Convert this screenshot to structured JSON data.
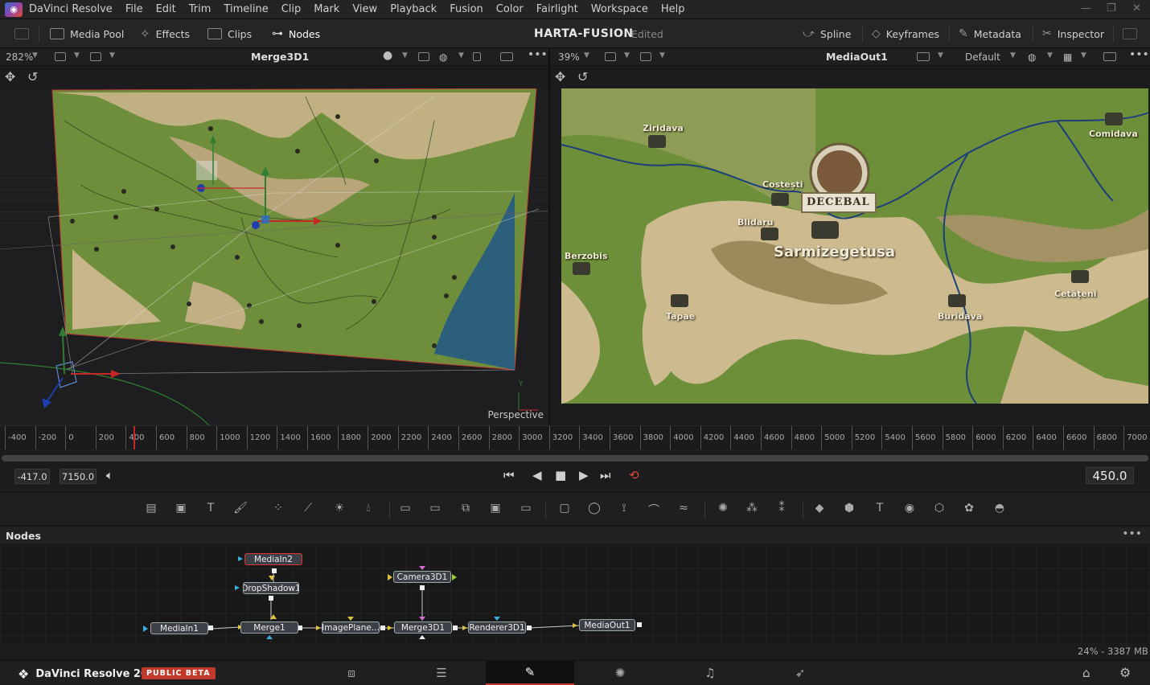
{
  "app": {
    "name": "DaVinci Resolve"
  },
  "menu": [
    "File",
    "Edit",
    "Trim",
    "Timeline",
    "Clip",
    "Mark",
    "View",
    "Playback",
    "Fusion",
    "Color",
    "Fairlight",
    "Workspace",
    "Help"
  ],
  "toolbar": {
    "media_pool": "Media Pool",
    "effects": "Effects",
    "clips": "Clips",
    "nodes": "Nodes",
    "project_title": "HARTA-FUSION",
    "project_status": "Edited",
    "spline": "Spline",
    "keyframes": "Keyframes",
    "metadata": "Metadata",
    "inspector": "Inspector"
  },
  "viewer_left": {
    "zoom": "282%",
    "node_name": "Merge3D1",
    "view_label": "Perspective"
  },
  "viewer_right": {
    "zoom": "39%",
    "node_name": "MediaOut1",
    "lut": "Default"
  },
  "map_labels": {
    "ziridava": "Ziridava",
    "comidava": "Comidava",
    "costesti": "Costești",
    "blidaru": "Blidaru",
    "decebal": "DECEBAL",
    "sarmizegetusa": "Sarmizegetusa",
    "berzobis": "Berzobis",
    "tapae": "Tapae",
    "buridava": "Buridava",
    "cetateni": "Cetățeni"
  },
  "ruler": {
    "ticks": [
      "-400",
      "-200",
      "0",
      "200",
      "400",
      "600",
      "800",
      "1000",
      "1200",
      "1400",
      "1600",
      "1800",
      "2000",
      "2200",
      "2400",
      "2600",
      "2800",
      "3000",
      "3200",
      "3400",
      "3600",
      "3800",
      "4000",
      "4200",
      "4400",
      "4600",
      "4800",
      "5000",
      "5200",
      "5400",
      "5600",
      "5800",
      "6000",
      "6200",
      "6400",
      "6600",
      "6800",
      "7000"
    ]
  },
  "transport": {
    "render_start": "-417.0",
    "render_end": "7150.0",
    "current_frame": "450.0"
  },
  "nodes_panel": {
    "title": "Nodes",
    "nodes": [
      "MediaIn2",
      "DropShadow1",
      "Camera3D1",
      "MediaIn1",
      "Merge1",
      "ImagePlane...",
      "Merge3D1",
      "Renderer3D1",
      "MediaOut1"
    ]
  },
  "status": {
    "memory": "24% - 3387 MB"
  },
  "pagebar": {
    "brand": "DaVinci Resolve 20",
    "badge": "PUBLIC BETA"
  },
  "colors": {
    "accent_red": "#c0392b",
    "map_green": "#6d8f3a",
    "map_sand": "#cbb98c",
    "water_blue": "#2f6f8f"
  }
}
